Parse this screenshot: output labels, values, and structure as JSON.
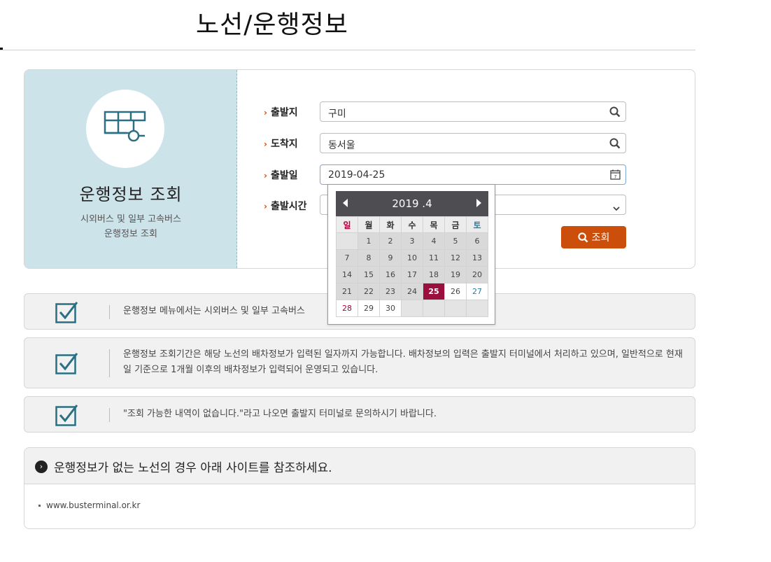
{
  "page": {
    "title": "노선/운행정보"
  },
  "search_panel": {
    "heading": "운행정보 조회",
    "desc_line1": "시외버스 및 일부 고속버스",
    "desc_line2": "운행정보 조회",
    "fields": [
      {
        "label": "출발지",
        "value": "구미",
        "icon": "search-icon"
      },
      {
        "label": "도착지",
        "value": "동서울",
        "icon": "search-icon"
      },
      {
        "label": "출발일",
        "value": "2019-04-25",
        "icon": "calendar-icon"
      },
      {
        "label": "출발시간",
        "value": "",
        "icon": "chevron-down-icon"
      }
    ],
    "submit_label": "조회"
  },
  "calendar": {
    "title": "2019 .4",
    "weekdays": [
      "일",
      "월",
      "화",
      "수",
      "목",
      "금",
      "토"
    ],
    "weeks": [
      [
        "",
        "1",
        "2",
        "3",
        "4",
        "5",
        "6"
      ],
      [
        "7",
        "8",
        "9",
        "10",
        "11",
        "12",
        "13"
      ],
      [
        "14",
        "15",
        "16",
        "17",
        "18",
        "19",
        "20"
      ],
      [
        "21",
        "22",
        "23",
        "24",
        "25",
        "26",
        "27"
      ],
      [
        "28",
        "29",
        "30",
        "",
        "",
        "",
        ""
      ]
    ],
    "selected_day": "25"
  },
  "notices": [
    "운행정보 메뉴에서는 시외버스 및 일부 고속버스 ",
    "운행정보 조회기간은 해당 노선의 배차정보가 입력된 일자까지 가능합니다. 배차정보의 입력은 출발지 터미널에서 처리하고 있으며, 일반적으로 현재일 기준으로 1개월 이후의 배차정보가 입력되어 운영되고 있습니다.",
    "\"조회 가능한 내역이 없습니다.\"라고 나오면 출발지 터미널로 문의하시기 바랍니다."
  ],
  "links": {
    "heading": "운행정보가 없는 노선의 경우 아래 사이트를 참조하세요.",
    "items": [
      "www.busterminal.or.kr"
    ]
  },
  "colors": {
    "accent": "#cc4e0b",
    "panel_bg": "#cde3ea",
    "selected_date": "#9b0f3f"
  }
}
